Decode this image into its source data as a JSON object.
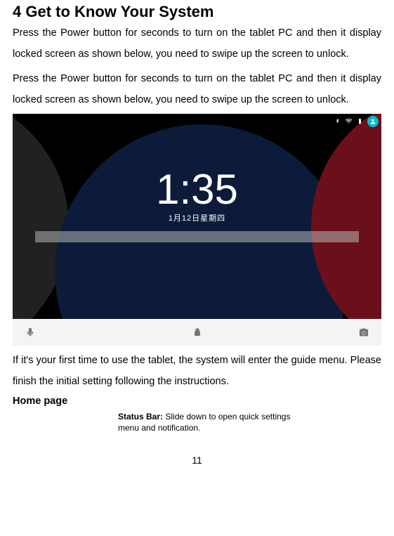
{
  "heading": "4 Get to Know Your System",
  "para1": "Press the Power button for seconds to turn on the tablet PC and then it display locked screen as shown below, you need to swipe up the screen to unlock.",
  "para2": "Press the Power button for seconds to turn on the tablet PC and then it display locked screen as shown below, you need to swipe up the screen to unlock.",
  "para3": "If it's your first time to use the tablet, the system will enter the guide menu. Please finish the initial setting following the instructions.",
  "subheading": "Home page",
  "caption_label": "Status Bar: ",
  "caption_text": "Slide down to open quick settings menu and notification.",
  "page_number": "11",
  "lockscreen": {
    "time": "1:35",
    "date": "1月12日星期四"
  }
}
